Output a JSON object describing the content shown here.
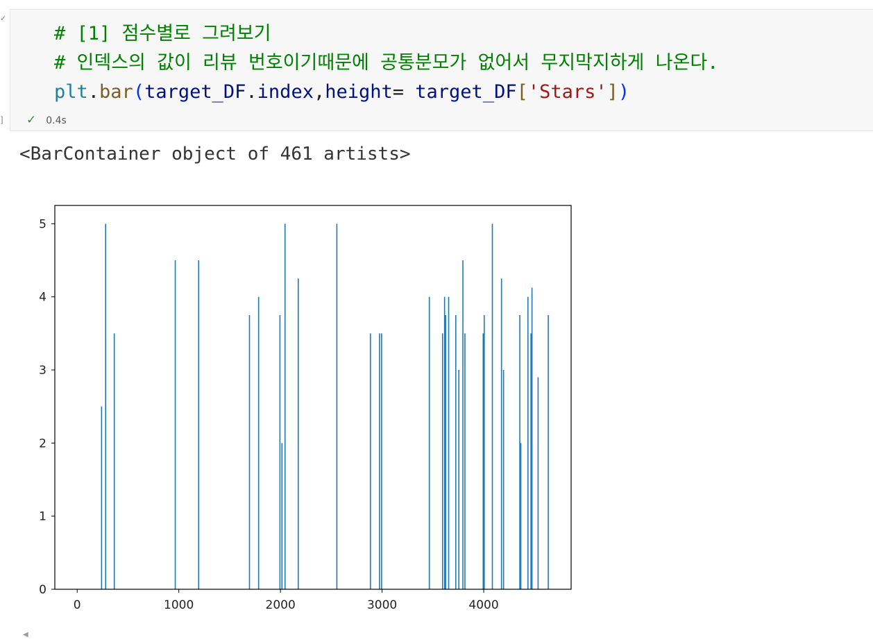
{
  "cell": {
    "code_lines": {
      "comment1": "# [1] 점수별로 그려보기",
      "comment2": "# 인덱스의 값이 리뷰 번호이기때문에 공통분모가 없어서 무지막지하게 나온다.",
      "tok_plt": "plt",
      "tok_dot1": ".",
      "tok_bar": "bar",
      "tok_lparen": "(",
      "tok_target1": "target_DF",
      "tok_dot2": ".",
      "tok_index": "index",
      "tok_comma": ",",
      "tok_height": "height",
      "tok_eq": "= ",
      "tok_target2": "target_DF",
      "tok_lbracket": "[",
      "tok_str": "'Stars'",
      "tok_rbracket": "]",
      "tok_rparen": ")"
    },
    "exec_time": "0.4s",
    "check_symbol": "✓",
    "gutter_bracket": "]",
    "gutter_mark": "✓"
  },
  "output": {
    "text": "<BarContainer object of 461 artists>"
  },
  "colors": {
    "bar": "#1f77b4",
    "comment": "#008000",
    "string": "#a31515"
  },
  "chart_data": {
    "type": "bar",
    "title": "",
    "xlabel": "",
    "ylabel": "",
    "xlim": [
      -220,
      4860
    ],
    "ylim": [
      0,
      5.25
    ],
    "xticks": [
      0,
      1000,
      2000,
      3000,
      4000
    ],
    "yticks": [
      0,
      1,
      2,
      3,
      4,
      5
    ],
    "grid": false,
    "x": [
      240,
      280,
      365,
      965,
      1195,
      1695,
      1785,
      1995,
      2015,
      2045,
      2175,
      2555,
      2885,
      2975,
      2995,
      3465,
      3595,
      3615,
      3625,
      3655,
      3725,
      3755,
      3795,
      3815,
      3995,
      4005,
      4085,
      4175,
      4195,
      4355,
      4365,
      4435,
      4465,
      4475,
      4535,
      4635
    ],
    "values": [
      2.5,
      5,
      3.5,
      4.5,
      4.5,
      3.75,
      4,
      3.75,
      2,
      5,
      4.25,
      5,
      3.5,
      3.5,
      3.5,
      4,
      3.5,
      4,
      3.75,
      4,
      3.75,
      3,
      4.5,
      3.5,
      3.5,
      3.75,
      5,
      4.25,
      3,
      3.75,
      2,
      4,
      3.5,
      4.125,
      2.9,
      3.75
    ]
  }
}
